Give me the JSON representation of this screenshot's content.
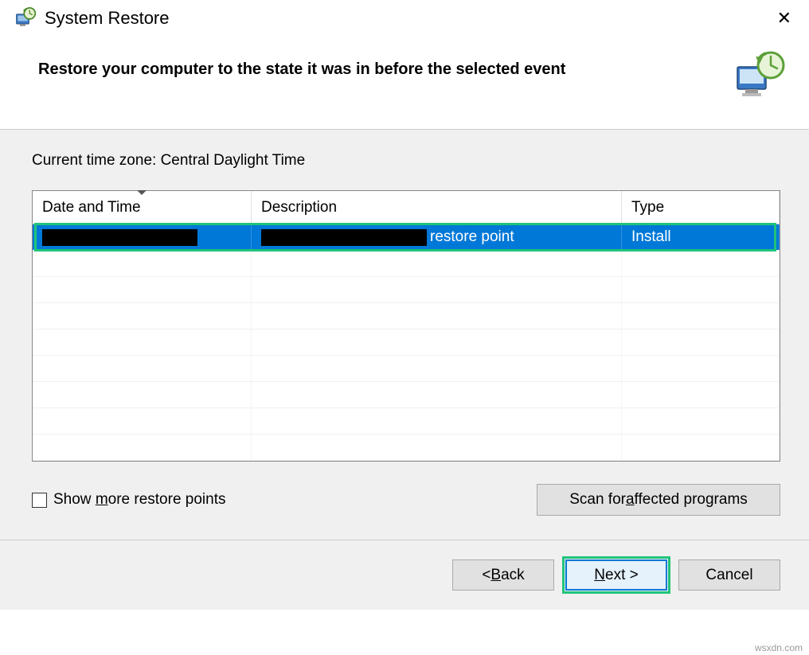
{
  "window": {
    "title": "System Restore"
  },
  "header": {
    "instruction": "Restore your computer to the state it was in before the selected event"
  },
  "content": {
    "timezone_label": "Current time zone: Central Daylight Time"
  },
  "table": {
    "columns": {
      "date": "Date and Time",
      "description": "Description",
      "type": "Type"
    },
    "rows": [
      {
        "date_redacted": true,
        "description_suffix": "restore point",
        "type": "Install",
        "selected": true
      }
    ],
    "empty_rows": 8
  },
  "controls": {
    "show_more_prefix": "Show ",
    "show_more_underline": "m",
    "show_more_suffix": "ore restore points",
    "scan_prefix": "Scan for ",
    "scan_underline": "a",
    "scan_suffix": "ffected programs"
  },
  "footer": {
    "back_prefix": "< ",
    "back_underline": "B",
    "back_suffix": "ack",
    "next_underline": "N",
    "next_suffix": "ext >",
    "cancel": "Cancel"
  },
  "watermark": "wsxdn.com"
}
